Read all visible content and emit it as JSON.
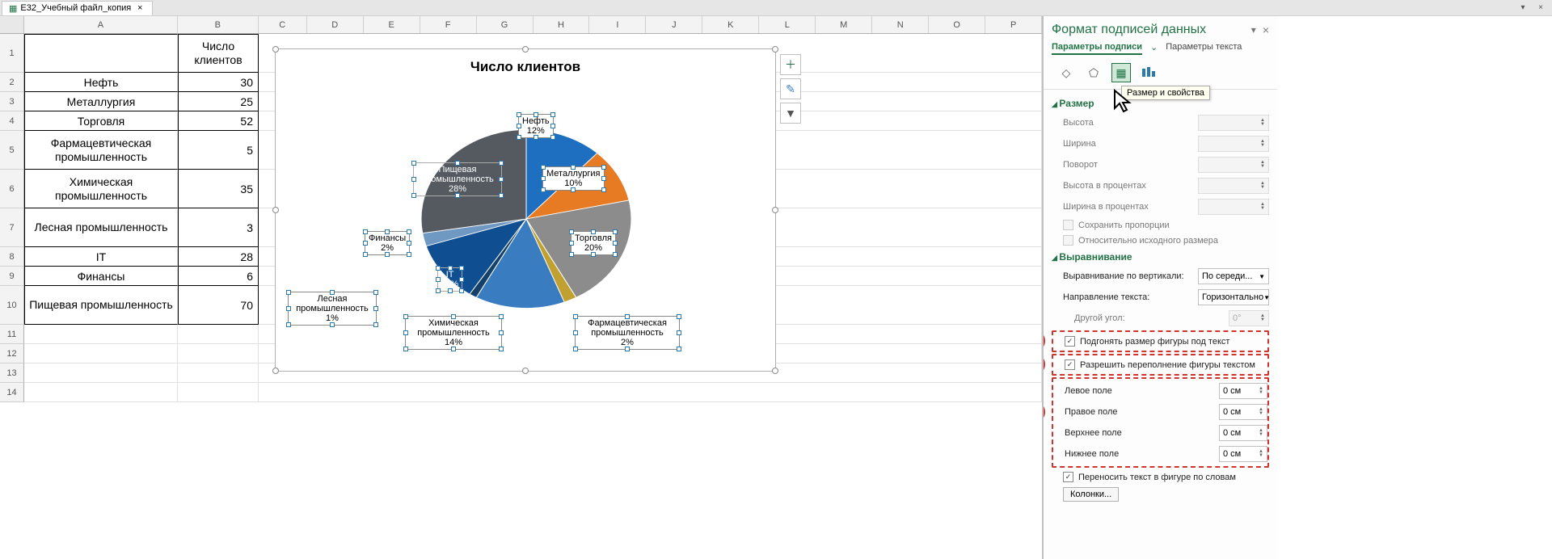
{
  "titlebar": {
    "doc_name": "E32_Учебный файл_копия"
  },
  "columns": [
    "A",
    "B",
    "C",
    "D",
    "E",
    "F",
    "G",
    "H",
    "I",
    "J",
    "K",
    "L",
    "M",
    "N",
    "O",
    "P"
  ],
  "table_header": {
    "a": "",
    "b": "Число клиентов"
  },
  "table_rows": [
    {
      "a": "Нефть",
      "b": "30"
    },
    {
      "a": "Металлургия",
      "b": "25"
    },
    {
      "a": "Торговля",
      "b": "52"
    },
    {
      "a": "Фармацевтическая промышленность",
      "b": "5"
    },
    {
      "a": "Химическая промышленность",
      "b": "35"
    },
    {
      "a": "Лесная промышленность",
      "b": "3"
    },
    {
      "a": "IT",
      "b": "28"
    },
    {
      "a": "Финансы",
      "b": "6"
    },
    {
      "a": "Пищевая промышленность",
      "b": "70"
    }
  ],
  "chart_data": {
    "type": "pie",
    "title": "Число клиентов",
    "categories": [
      "Нефть",
      "Металлургия",
      "Торговля",
      "Фармацевтическая промышленность",
      "Химическая промышленность",
      "Лесная промышленность",
      "IT",
      "Финансы",
      "Пищевая промышленность"
    ],
    "values": [
      30,
      25,
      52,
      5,
      35,
      3,
      28,
      6,
      70
    ],
    "percent": [
      12,
      10,
      20,
      2,
      14,
      1,
      11,
      2,
      28
    ],
    "colors": [
      "#1f6fc0",
      "#e67b24",
      "#8c8c8c",
      "#c0a030",
      "#3a7cc0",
      "#14406a",
      "#0f4f91",
      "#6f99c2",
      "#555a60"
    ],
    "labels": {
      "0": "Нефть\n12%",
      "1": "Металлургия\n10%",
      "2": "Торговля\n20%",
      "3": "Фармацевтическая промышленность\n2%",
      "4": "Химическая промышленность\n14%",
      "5": "Лесная промышленность\n1%",
      "6": "IT\n11%",
      "7": "Финансы\n2%",
      "8": "Пищевая промышленность\n28%"
    }
  },
  "taskpane": {
    "title": "Формат подписей данных",
    "tabs": {
      "options": "Параметры подписи",
      "text": "Параметры текста"
    },
    "icon_tooltip": "Размер и свойства",
    "size_section": "Размер",
    "size": {
      "height": "Высота",
      "width": "Ширина",
      "rotation": "Поворот",
      "height_pct": "Высота в процентах",
      "width_pct": "Ширина в процентах",
      "lock_aspect": "Сохранить пропорции",
      "relative": "Относительно исходного размера"
    },
    "align_section": "Выравнивание",
    "align": {
      "valign_label": "Выравнивание по вертикали:",
      "valign_value": "По середи...",
      "dir_label": "Направление текста:",
      "dir_value": "Горизонтально",
      "angle_label": "Другой угол:",
      "angle_value": "0°",
      "autofit": "Подгонять размер фигуры под текст",
      "overflow": "Разрешить переполнение фигуры текстом",
      "left_margin": "Левое поле",
      "left_val": "0 см",
      "right_margin": "Правое поле",
      "right_val": "0 см",
      "top_margin": "Верхнее поле",
      "top_val": "0 см",
      "bottom_margin": "Нижнее поле",
      "bottom_val": "0 см",
      "wrap": "Переносить текст в фигуре по словам",
      "columns_btn": "Колонки..."
    }
  }
}
